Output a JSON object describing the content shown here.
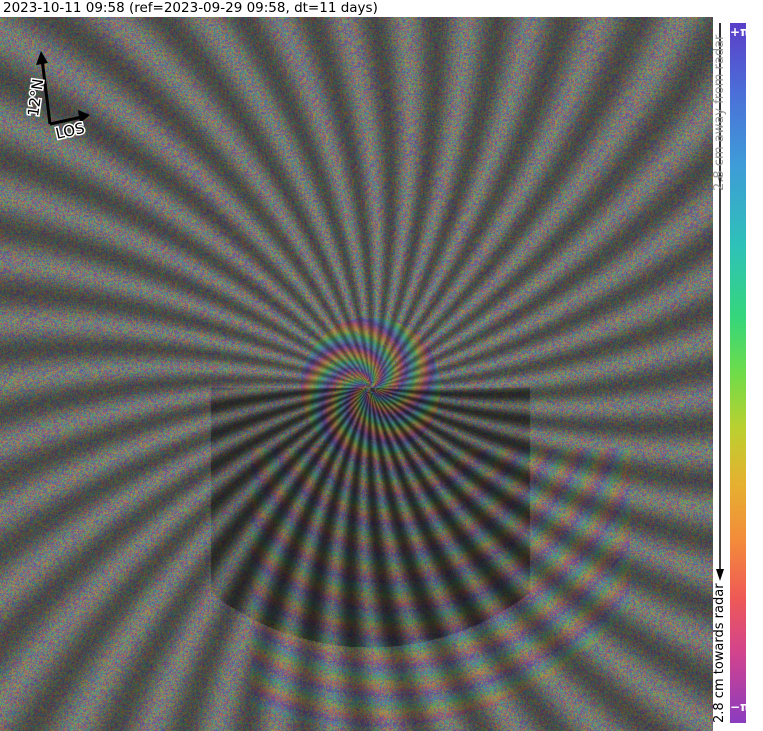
{
  "header": {
    "title": "2023-10-11 09:58 (ref=2023-09-29 09:58, dt=11 days)"
  },
  "compass": {
    "north_label": "12°N",
    "los_label": "LOS",
    "arrow_color": "#000000"
  },
  "colorbar": {
    "top_label": "+π",
    "bottom_label": "−π",
    "away_label": "2.8 cm away from radar",
    "towards_label": "2.8 cm towards radar",
    "colors": [
      "#5b3ec8",
      "#4b6fd8",
      "#3f9bd8",
      "#2ec2b8",
      "#35d67c",
      "#6fdc4a",
      "#bcd030",
      "#e6b030",
      "#f38b3b",
      "#ef5a55",
      "#d2438d",
      "#8a3cc0"
    ]
  }
}
